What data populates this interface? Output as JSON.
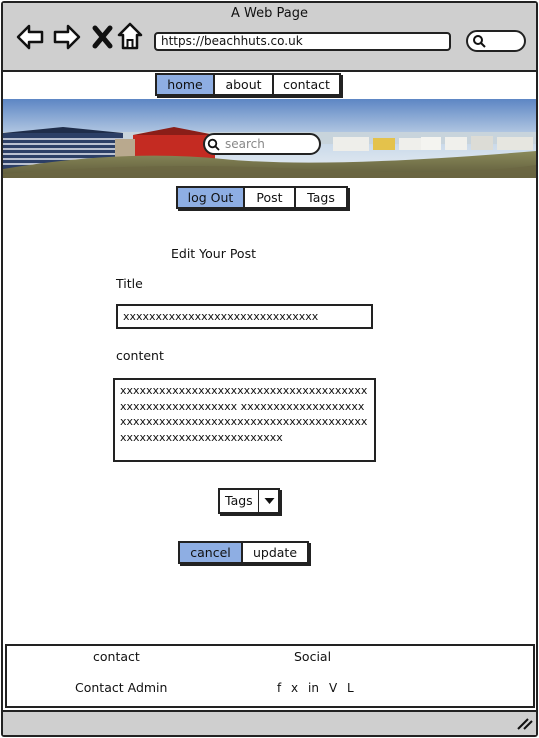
{
  "browser": {
    "window_title": "A Web Page",
    "url": "https://beachhuts.co.uk"
  },
  "topnav": {
    "items": [
      {
        "label": "home"
      },
      {
        "label": "about"
      },
      {
        "label": "contact"
      }
    ]
  },
  "hero": {
    "search_placeholder": "search"
  },
  "subnav": {
    "items": [
      {
        "label": "log Out"
      },
      {
        "label": "Post"
      },
      {
        "label": "Tags"
      }
    ]
  },
  "form": {
    "heading": "Edit Your Post",
    "title_label": "Title",
    "title_value": "xxxxxxxxxxxxxxxxxxxxxxxxxxxxxx",
    "content_label": "content",
    "content_value": "xxxxxxxxxxxxxxxxxxxxxxxxxxxxxxxxxxxxxxxxxxxxxxxxxxxxxxxx xxxxxxxxxxxxxxxxxxxxxxxxxxxxxxxxxxxxxxxxxxxxxxxxxxxxxxxxxxxxxxxxxxxxxxxxxxxxxxxxxx",
    "tags_select": "Tags",
    "cancel_label": "cancel",
    "update_label": "update"
  },
  "footer": {
    "contact_heading": "contact",
    "contact_admin": "Contact Admin",
    "social_heading": "Social",
    "social_links": [
      "f",
      "x",
      "in",
      "V",
      "L"
    ]
  },
  "colors": {
    "accent": "#8eaee3",
    "chrome": "#cfcfcf",
    "border": "#222222"
  }
}
